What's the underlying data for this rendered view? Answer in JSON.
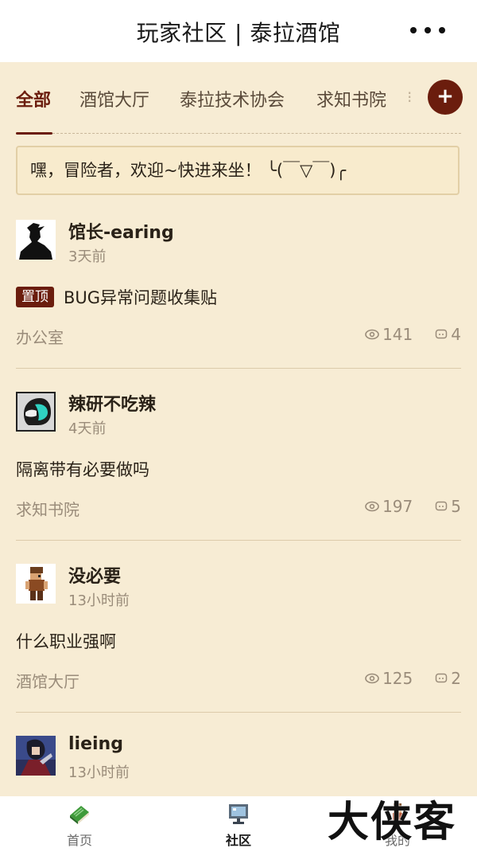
{
  "header": {
    "title": "玩家社区 | 泰拉酒馆",
    "more_icon": "more-dots-icon"
  },
  "tabs": [
    {
      "label": "全部",
      "active": true
    },
    {
      "label": "酒馆大厅",
      "active": false
    },
    {
      "label": "泰拉技术协会",
      "active": false
    },
    {
      "label": "求知书院",
      "active": false
    }
  ],
  "add_button": {
    "label": "+"
  },
  "notice": {
    "text": "嘿，冒险者，欢迎~快进来坐！ ╰(￣▽￣)╭"
  },
  "posts": [
    {
      "author": "馆长-earing",
      "time": "3天前",
      "pinned_label": "置顶",
      "title": "BUG异常问题收集贴",
      "category": "办公室",
      "views": "141",
      "comments": "4"
    },
    {
      "author": "辣研不吃辣",
      "time": "4天前",
      "title": "隔离带有必要做吗",
      "category": "求知书院",
      "views": "197",
      "comments": "5"
    },
    {
      "author": "没必要",
      "time": "13小时前",
      "title": "什么职业强啊",
      "category": "酒馆大厅",
      "views": "125",
      "comments": "2"
    },
    {
      "author": "lieing",
      "time": "13小时前"
    }
  ],
  "bottom_nav": [
    {
      "label": "首页",
      "icon": "book-icon"
    },
    {
      "label": "社区",
      "icon": "computer-icon",
      "active": true
    },
    {
      "label": "我的",
      "icon": "character-icon"
    }
  ],
  "watermark": {
    "text": "大侠客"
  },
  "colors": {
    "accent": "#6b1d0d",
    "background": "#f7ecd4",
    "muted_text": "#9a8c7a"
  }
}
